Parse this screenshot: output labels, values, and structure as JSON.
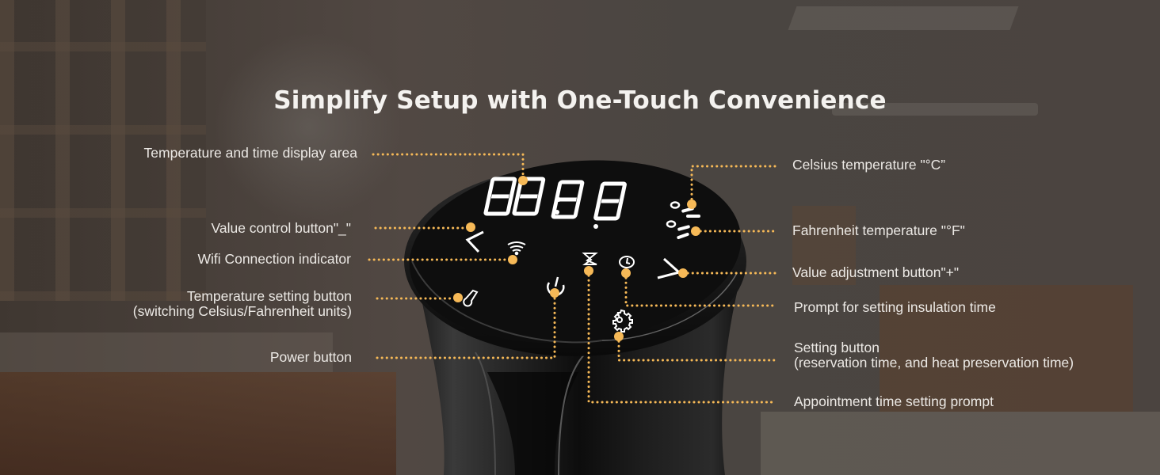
{
  "title": "Simplify Setup with One-Touch Convenience",
  "device": {
    "display_digits": "88:8.8",
    "unit_indicators": [
      "°C",
      "°F"
    ],
    "icons": [
      "chevron-left-icon",
      "wifi-icon",
      "thermometer-icon",
      "power-icon",
      "hourglass-icon",
      "clock-icon",
      "chevron-right-icon",
      "gear-icon"
    ]
  },
  "callouts": {
    "left": [
      {
        "id": "display-area",
        "lines": [
          "Temperature and time display area"
        ]
      },
      {
        "id": "value-minus",
        "lines": [
          "Value control button\"_\""
        ]
      },
      {
        "id": "wifi",
        "lines": [
          "Wifi Connection indicator"
        ]
      },
      {
        "id": "temp-setting",
        "lines": [
          "Temperature setting button",
          "(switching Celsius/Fahrenheit units)"
        ]
      },
      {
        "id": "power",
        "lines": [
          "Power button"
        ]
      }
    ],
    "right": [
      {
        "id": "celsius",
        "lines": [
          "Celsius temperature \"°C”"
        ]
      },
      {
        "id": "fahrenheit",
        "lines": [
          "Fahrenheit temperature \"°F\""
        ]
      },
      {
        "id": "value-plus",
        "lines": [
          "Value adjustment button\"+\""
        ]
      },
      {
        "id": "insulation",
        "lines": [
          "Prompt for setting insulation time"
        ]
      },
      {
        "id": "setting",
        "lines": [
          "Setting button",
          "(reservation time, and heat preservation time)"
        ]
      },
      {
        "id": "appointment",
        "lines": [
          "Appointment time setting prompt"
        ]
      }
    ]
  },
  "colors": {
    "accent": "#f6b957",
    "text": "#ece9e5",
    "device": "#0e0e0e"
  }
}
